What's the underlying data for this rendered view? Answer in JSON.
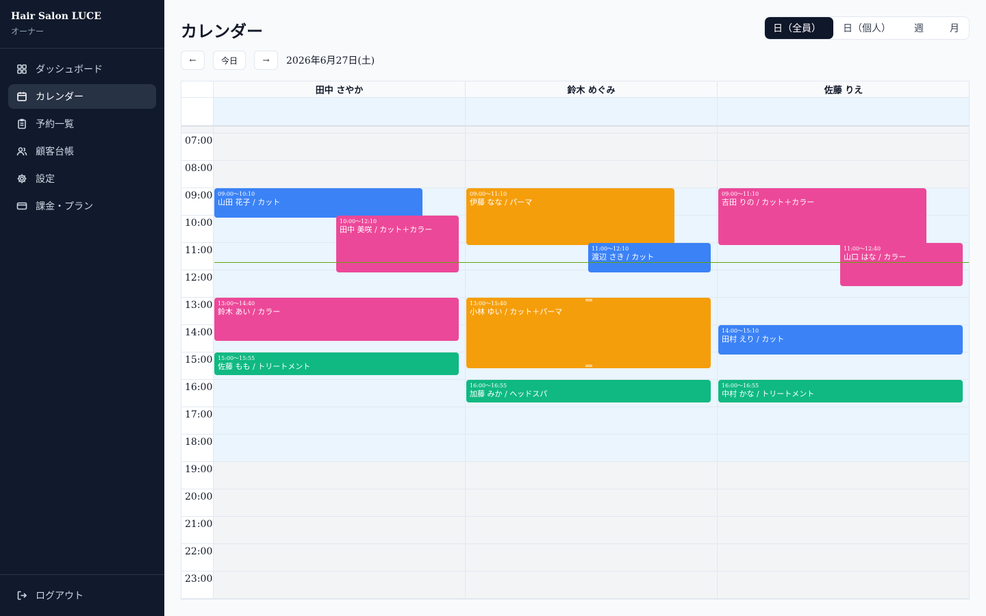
{
  "sidebar": {
    "brand_name": "Hair Salon LUCE",
    "brand_role": "オーナー",
    "items": [
      {
        "label": "ダッシュボード",
        "icon": "dashboard-icon"
      },
      {
        "label": "カレンダー",
        "icon": "calendar-icon",
        "active": true
      },
      {
        "label": "予約一覧",
        "icon": "clipboard-icon"
      },
      {
        "label": "顧客台帳",
        "icon": "users-icon"
      },
      {
        "label": "設定",
        "icon": "gear-icon"
      },
      {
        "label": "課金・プラン",
        "icon": "credit-card-icon"
      }
    ],
    "logout_label": "ログアウト"
  },
  "header": {
    "title": "カレンダー",
    "views": [
      "日（全員）",
      "日（個人）",
      "週",
      "月"
    ],
    "active_view": "日（全員）"
  },
  "date_nav": {
    "prev": "←",
    "today": "今日",
    "next": "→",
    "date": "2026年6月27日(土)"
  },
  "calendar": {
    "staff": [
      "田中 さやか",
      "鈴木 めぐみ",
      "佐藤 りえ"
    ],
    "hours": [
      "07:00",
      "08:00",
      "09:00",
      "10:00",
      "11:00",
      "12:00",
      "13:00",
      "14:00",
      "15:00",
      "16:00",
      "17:00",
      "18:00",
      "19:00",
      "20:00",
      "21:00",
      "22:00",
      "23:00"
    ],
    "business_hours": [
      "09:00",
      "19:00"
    ],
    "current_time": "11:42",
    "colors": {
      "blue": "#3b82f6",
      "pink": "#ec4899",
      "orange": "#f59e0b",
      "green": "#10b981"
    },
    "events": [
      {
        "staff": 0,
        "time": "09:00〜10:10",
        "title": "山田 花子 / カット",
        "color": "blue"
      },
      {
        "staff": 0,
        "time": "10:00〜12:10",
        "title": "田中 美咲 / カット＋カラー",
        "color": "pink"
      },
      {
        "staff": 0,
        "time": "13:00〜14:40",
        "title": "鈴木 あい / カラー",
        "color": "pink"
      },
      {
        "staff": 0,
        "time": "15:00〜15:55",
        "title": "佐藤 もも / トリートメント",
        "color": "green"
      },
      {
        "staff": 1,
        "time": "09:00〜11:10",
        "title": "伊藤 なな / パーマ",
        "color": "orange"
      },
      {
        "staff": 1,
        "time": "11:00〜12:10",
        "title": "渡辺 さき / カット",
        "color": "blue"
      },
      {
        "staff": 1,
        "time": "13:00〜15:40",
        "title": "小林 ゆい / カット＋パーマ",
        "color": "orange"
      },
      {
        "staff": 1,
        "time": "16:00〜16:55",
        "title": "加藤 みか / ヘッドスパ",
        "color": "green"
      },
      {
        "staff": 2,
        "time": "09:00〜11:10",
        "title": "吉田 りの / カット＋カラー",
        "color": "pink"
      },
      {
        "staff": 2,
        "time": "11:00〜12:40",
        "title": "山口 はな / カラー",
        "color": "pink"
      },
      {
        "staff": 2,
        "time": "14:00〜15:10",
        "title": "田村 えり / カット",
        "color": "blue"
      },
      {
        "staff": 2,
        "time": "16:00〜16:55",
        "title": "中村 かな / トリートメント",
        "color": "green"
      }
    ]
  }
}
